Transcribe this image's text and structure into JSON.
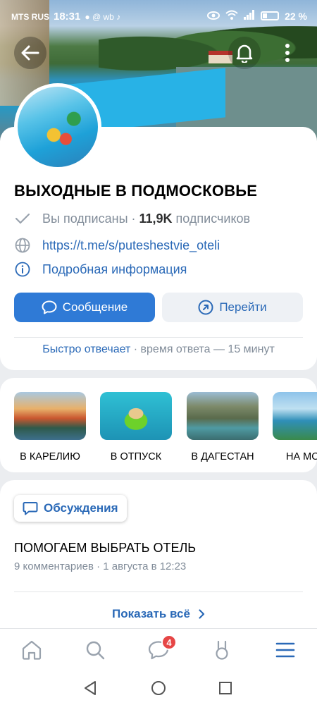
{
  "status_bar": {
    "carrier": "MTS RUS",
    "time": "18:31",
    "notif_icons": "● @ wb ♪",
    "battery": "22 %"
  },
  "community": {
    "name": "ВЫХОДНЫЕ В ПОДМОСКОВЬЕ",
    "subscribed_text": "Вы подписаны",
    "separator": " · ",
    "subscribers_count": "11,9K",
    "subscribers_suffix": " подписчиков",
    "link": "https://t.me/s/puteshestvie_oteli",
    "more_info": "Подробная информация"
  },
  "actions": {
    "message_label": "Сообщение",
    "go_label": "Перейти"
  },
  "response": {
    "highlight": "Быстро отвечает",
    "separator": " · ",
    "text": "время ответа — 15 минут"
  },
  "stories": [
    {
      "label": "В КАРЕЛИЮ"
    },
    {
      "label": "В ОТПУСК"
    },
    {
      "label": "В ДАГЕСТАН"
    },
    {
      "label": "НА МО"
    }
  ],
  "discussions": {
    "chip_label": "Обсуждения",
    "topic_title": "ПОМОГАЕМ ВЫБРАТЬ ОТЕЛЬ",
    "topic_meta": "9 комментариев · 1 августа в 12:23",
    "show_all": "Показать всё"
  },
  "tabbar": {
    "messages_badge": "4"
  },
  "colors": {
    "accent": "#2a69b7",
    "primary_button": "#2f7ad6",
    "badge": "#e64646"
  }
}
